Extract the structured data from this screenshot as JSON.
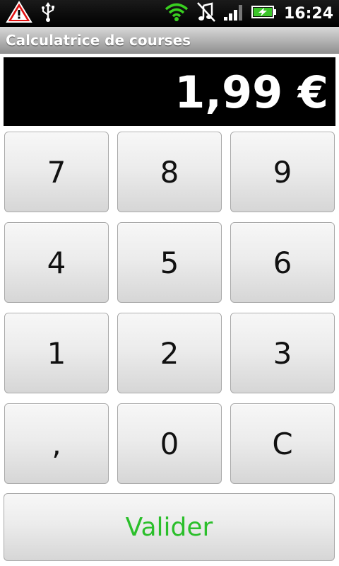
{
  "status_bar": {
    "time": "16:24",
    "icons": [
      "warning-icon",
      "usb-icon",
      "wifi-icon",
      "silent-icon",
      "signal-icon",
      "battery-charging-icon"
    ]
  },
  "app": {
    "title": "Calculatrice de courses"
  },
  "display": {
    "value": "1,99 €"
  },
  "keypad": {
    "rows": [
      [
        "7",
        "8",
        "9"
      ],
      [
        "4",
        "5",
        "6"
      ],
      [
        "1",
        "2",
        "3"
      ],
      [
        ",",
        "0",
        "C"
      ]
    ],
    "validate_label": "Valider"
  },
  "colors": {
    "validate_text": "#2bbf2b",
    "display_bg": "#000000",
    "display_text": "#ffffff"
  }
}
